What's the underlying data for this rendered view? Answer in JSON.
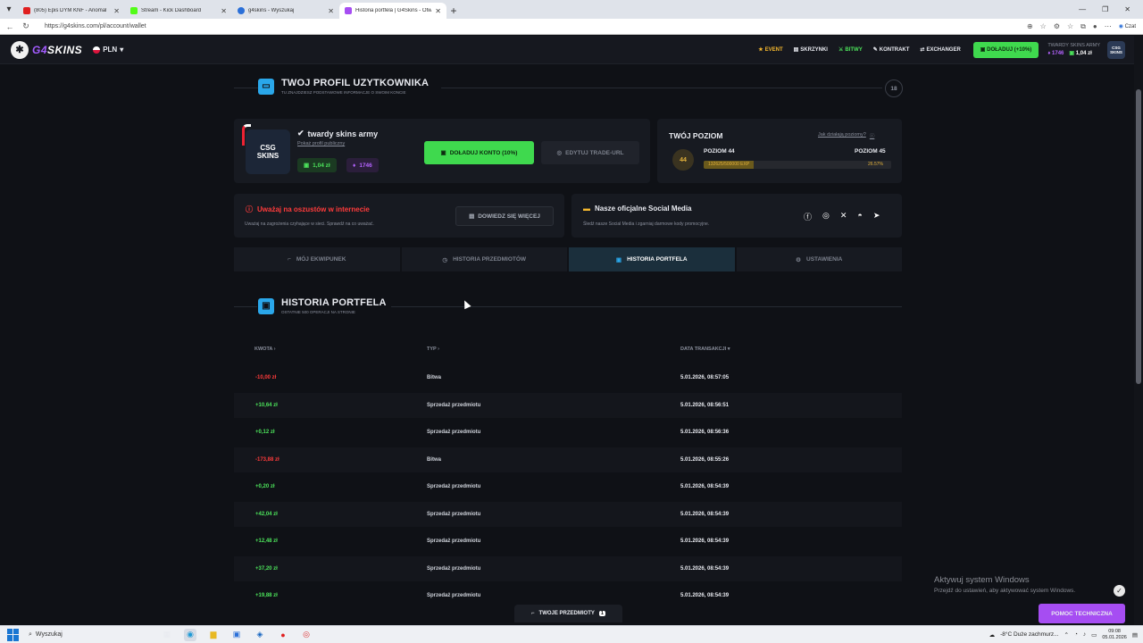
{
  "browser": {
    "tabs": [
      {
        "title": "(805) Epis DYM KNF - Anomal",
        "color": "#e02020"
      },
      {
        "title": "Stream - Kick Dashboard",
        "color": "#53fc18"
      },
      {
        "title": "g4skins - Wyszukaj",
        "color": "#2a6fd8"
      },
      {
        "title": "Historia portfela | G4Skins - Otwie",
        "color": "#a64df2"
      }
    ],
    "url": "https://g4skins.com/pl/account/wallet",
    "copilot_label": "Czat"
  },
  "header": {
    "logo_g4": "G4",
    "logo_skins": "SKINS",
    "currency": "PLN",
    "nav": [
      "EVENT",
      "SKRZYNKI",
      "BITWY",
      "KONTRAKT",
      "EXCHANGER"
    ],
    "deposit": "DOŁADUJ (+10%)",
    "username": "TWARDY SKINS ARMY",
    "points": "1746",
    "balance": "1,04 zł",
    "avatar_text": "CSG SKINS"
  },
  "profile": {
    "title": "TWOJ PROFIL UZYTKOWNIKA",
    "subtitle": "TU ZNAJDZIESZ PODSTAWOWE INFORMACJE O SWOIM KONCIE",
    "level_badge": "18",
    "avatar_line1": "CSG",
    "avatar_line2": "SKINS",
    "name": "twardy skins army",
    "public_link": "Pokaż profil publiczny",
    "balance": "1,04 zł",
    "points": "1746",
    "deposit_btn": "DOŁADUJ KONTO (10%)",
    "edit_btn": "EDYTUJ TRADE-URL"
  },
  "level": {
    "title": "TWÓJ POZIOM",
    "help": "Jak działają poziomy?",
    "badge": "44",
    "current": "POZIOM 44",
    "next": "POZIOM 45",
    "exp": "132625/500000 EXP",
    "percent_label": "26.57%",
    "progress": 0.2657
  },
  "warning": {
    "title": "Uważaj na oszustów w internecie",
    "subtitle": "Uważaj na zagrożenia czyhające w sieci. Sprawdź na co uważać.",
    "button": "DOWIEDZ SIĘ WIĘCEJ"
  },
  "social": {
    "title": "Nasze oficjalne Social Media",
    "subtitle": "Śledź nasze Social Media i zgarniaj darmowe kody promocyjne."
  },
  "tabs": [
    "MÓJ EKWIPUNEK",
    "HISTORIA PRZEDMIOTÓW",
    "HISTORIA PORTFELA",
    "USTAWIENIA"
  ],
  "wallet": {
    "title": "HISTORIA PORTFELA",
    "subtitle": "OSTATNIE 500 OPERACJI NA STRONIE",
    "columns": [
      "KWOTA",
      "TYP",
      "DATA TRANSAKCJI"
    ],
    "rows": [
      {
        "amount": "-10,00 zł",
        "type": "Bitwa",
        "date": "5.01.2026, 08:57:05"
      },
      {
        "amount": "+10,64 zł",
        "type": "Sprzedaż przedmiotu",
        "date": "5.01.2026, 08:56:51"
      },
      {
        "amount": "+0,12 zł",
        "type": "Sprzedaż przedmiotu",
        "date": "5.01.2026, 08:56:36"
      },
      {
        "amount": "-173,88 zł",
        "type": "Bitwa",
        "date": "5.01.2026, 08:55:26"
      },
      {
        "amount": "+0,20 zł",
        "type": "Sprzedaż przedmiotu",
        "date": "5.01.2026, 08:54:39"
      },
      {
        "amount": "+42,04 zł",
        "type": "Sprzedaż przedmiotu",
        "date": "5.01.2026, 08:54:39"
      },
      {
        "amount": "+12,48 zł",
        "type": "Sprzedaż przedmiotu",
        "date": "5.01.2026, 08:54:39"
      },
      {
        "amount": "+37,20 zł",
        "type": "Sprzedaż przedmiotu",
        "date": "5.01.2026, 08:54:39"
      },
      {
        "amount": "+19,88 zł",
        "type": "Sprzedaż przedmiotu",
        "date": "5.01.2026, 08:54:39"
      }
    ]
  },
  "footer": {
    "items_label": "TWOJE PRZEDMIOTY",
    "items_count": "1",
    "help": "POMOC TECHNICZNA"
  },
  "windows": {
    "activate_title": "Aktywuj system Windows",
    "activate_sub": "Przejdź do ustawień, aby aktywować system Windows.",
    "search": "Wyszukaj",
    "weather": "-8°C  Duże zachmurz...",
    "time": "09:08",
    "date": "05.01.2026"
  }
}
